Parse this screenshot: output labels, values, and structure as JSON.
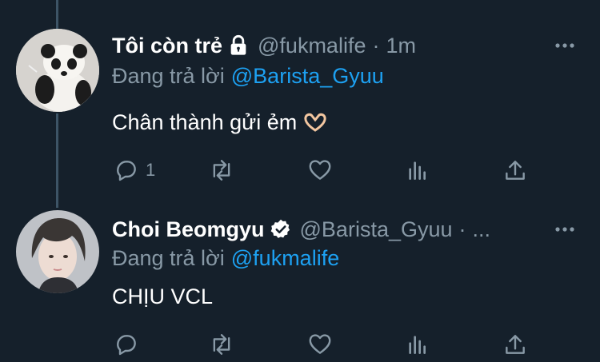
{
  "tweets": [
    {
      "display_name": "Tôi còn trẻ",
      "handle": "@fukmalife",
      "separator": "·",
      "time": "1m",
      "replying_label": "Đang trả lời",
      "replying_to": "@Barista_Gyuu",
      "text": "Chân thành gửi ẻm",
      "reply_count": "1",
      "badge_icon": "lock-icon",
      "emoji_icon": "heart-hands-emoji-icon"
    },
    {
      "display_name": "Choi Beomgyu",
      "handle": "@Barista_Gyuu",
      "separator": "·",
      "time": "...",
      "replying_label": "Đang trả lời",
      "replying_to": "@fukmalife",
      "text": "CHỊU VCL",
      "reply_count": "",
      "badge_icon": "verified-icon"
    }
  ],
  "colors": {
    "background": "#15202b",
    "secondary_text": "#8899a6",
    "link": "#1da1f2",
    "thread_line": "#3d5466"
  }
}
